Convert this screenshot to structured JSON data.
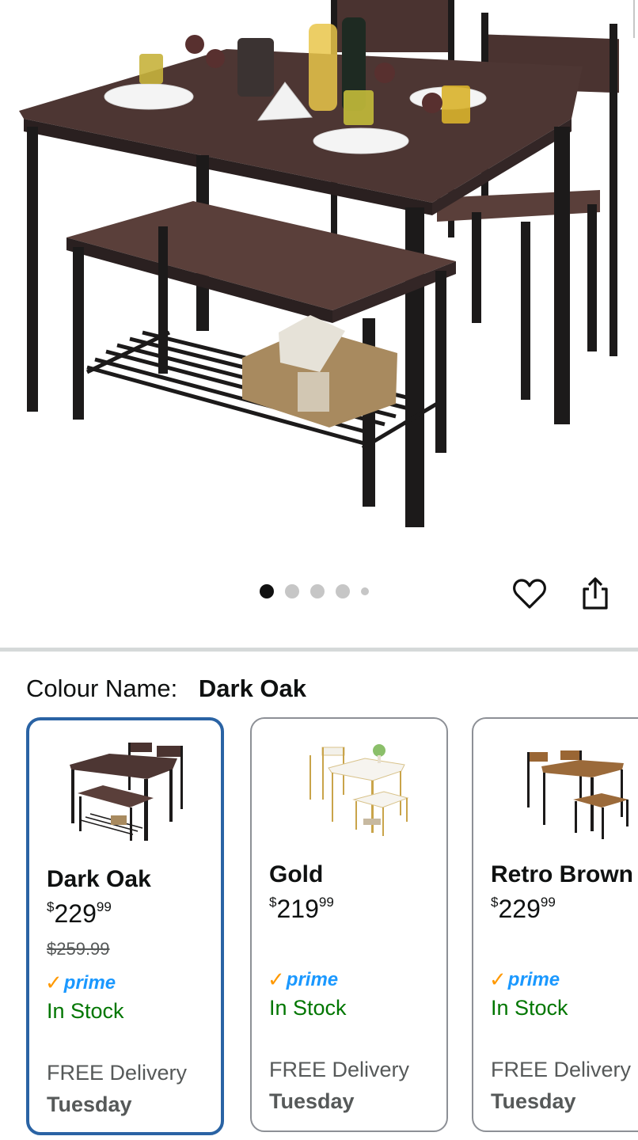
{
  "gallery": {
    "image_alt": "Dark oak dining table set with bench and two chairs",
    "image_count": 5,
    "active_index": 0
  },
  "icons": {
    "favorite": "heart-icon",
    "share": "share-icon"
  },
  "colour": {
    "label": "Colour Name:",
    "value": "Dark Oak"
  },
  "swatches": [
    {
      "name": "Dark Oak",
      "price_whole": "229",
      "price_fraction": "99",
      "currency": "$",
      "was_price": "$259.99",
      "prime": "prime",
      "stock": "In Stock",
      "delivery": "FREE Delivery",
      "day": "Tuesday",
      "selected": true
    },
    {
      "name": "Gold",
      "price_whole": "219",
      "price_fraction": "99",
      "currency": "$",
      "prime": "prime",
      "stock": "In Stock",
      "delivery": "FREE Delivery",
      "day": "Tuesday",
      "selected": false
    },
    {
      "name": "Retro Brown",
      "price_whole": "229",
      "price_fraction": "99",
      "currency": "$",
      "prime": "prime",
      "stock": "In Stock",
      "delivery": "FREE Delivery",
      "day": "Tuesday",
      "selected": false
    }
  ],
  "colors": {
    "selected_border": "#2a63a4",
    "stock_green": "#007600",
    "prime_blue": "#1a98ff",
    "prime_check": "#ff9900",
    "wood_dark": "#4a3330",
    "metal_dark": "#1c1a1a"
  }
}
